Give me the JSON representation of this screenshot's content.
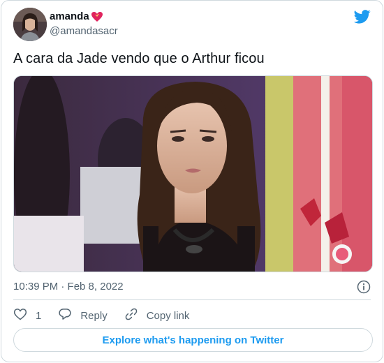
{
  "author": {
    "name": "amanda",
    "name_emoji": "heart-icon",
    "handle": "@amandasacr"
  },
  "tweet": {
    "text": "A cara da Jade vendo que o Arthur ficou",
    "timestamp": "10:39 PM · Feb 8, 2022"
  },
  "actions": {
    "like_count": "1",
    "reply_label": "Reply",
    "copy_link_label": "Copy link"
  },
  "explore_label": "Explore what's happening on Twitter",
  "colors": {
    "twitter_blue": "#1d9bf0",
    "secondary_text": "#536471",
    "border": "#cfd9de",
    "heart": "#e0245e"
  },
  "icons": [
    "twitter-bird-icon",
    "heart-icon",
    "info-icon",
    "like-icon",
    "reply-icon",
    "copy-link-icon"
  ]
}
